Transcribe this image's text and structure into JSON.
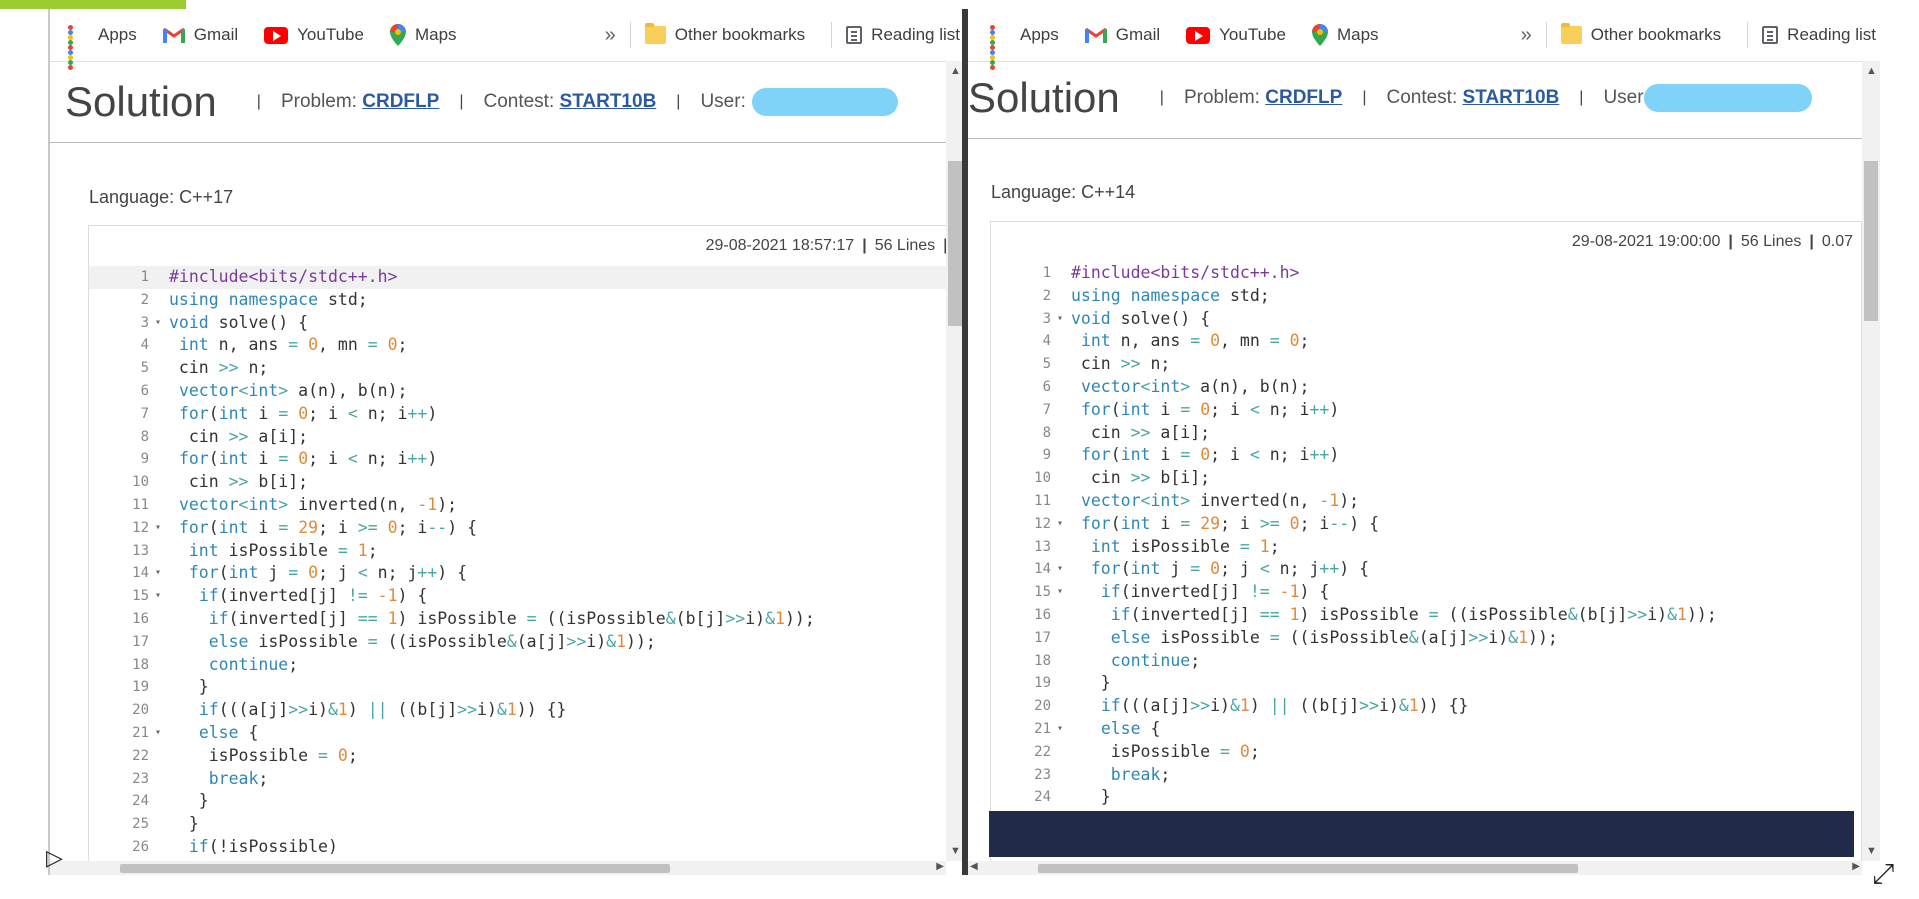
{
  "bookmarks": {
    "apps": "Apps",
    "gmail": "Gmail",
    "youtube": "YouTube",
    "maps": "Maps",
    "more": "»",
    "other": "Other bookmarks",
    "reading": "Reading list"
  },
  "colors": {
    "link": "#2c5aa0",
    "keyword": "#2e87b5",
    "number": "#e08a3c",
    "preprocessor": "#7b3a9b",
    "redaction": "#7fd3f9",
    "overlay": "#222a4a"
  },
  "left": {
    "title": "Solution",
    "problem_label": "Problem:",
    "problem": "CRDFLP",
    "contest_label": "Contest:",
    "contest": "START10B",
    "user_label": "User:",
    "language": "Language: C++17",
    "date": "29-08-2021 18:57:17",
    "lines": "56 Lines",
    "extra": "(",
    "code": [
      "#include<bits/stdc++.h>",
      "using namespace std;",
      "void solve() {",
      " int n, ans = 0, mn = 0;",
      " cin >> n;",
      " vector<int> a(n), b(n);",
      " for(int i = 0; i < n; i++)",
      "  cin >> a[i];",
      " for(int i = 0; i < n; i++)",
      "  cin >> b[i];",
      " vector<int> inverted(n, -1);",
      " for(int i = 29; i >= 0; i--) {",
      "  int isPossible = 1;",
      "  for(int j = 0; j < n; j++) {",
      "   if(inverted[j] != -1) {",
      "    if(inverted[j] == 1) isPossible = ((isPossible&(b[j]>>i)&1));",
      "    else isPossible = ((isPossible&(a[j]>>i)&1));",
      "    continue;",
      "   }",
      "   if(((a[j]>>i)&1) || ((b[j]>>i)&1)) {}",
      "   else {",
      "    isPossible = 0;",
      "    break;",
      "   }",
      "  }",
      "  if(!isPossible)"
    ]
  },
  "right": {
    "title": "Solution",
    "problem_label": "Problem:",
    "problem": "CRDFLP",
    "contest_label": "Contest:",
    "contest": "START10B",
    "user_label": "User",
    "language": "Language: C++14",
    "date": "29-08-2021 19:00:00",
    "lines": "56 Lines",
    "extra": "0.07",
    "code": [
      "#include<bits/stdc++.h>",
      "using namespace std;",
      "void solve() {",
      " int n, ans = 0, mn = 0;",
      " cin >> n;",
      " vector<int> a(n), b(n);",
      " for(int i = 0; i < n; i++)",
      "  cin >> a[i];",
      " for(int i = 0; i < n; i++)",
      "  cin >> b[i];",
      " vector<int> inverted(n, -1);",
      " for(int i = 29; i >= 0; i--) {",
      "  int isPossible = 1;",
      "  for(int j = 0; j < n; j++) {",
      "   if(inverted[j] != -1) {",
      "    if(inverted[j] == 1) isPossible = ((isPossible&(b[j]>>i)&1));",
      "    else isPossible = ((isPossible&(a[j]>>i)&1));",
      "    continue;",
      "   }",
      "   if(((a[j]>>i)&1) || ((b[j]>>i)&1)) {}",
      "   else {",
      "    isPossible = 0;",
      "    break;",
      "   }"
    ]
  }
}
